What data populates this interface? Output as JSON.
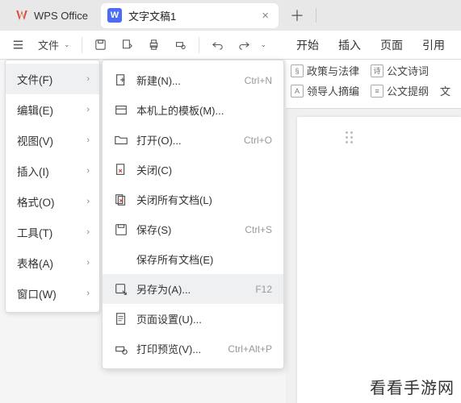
{
  "titlebar": {
    "app_name": "WPS Office",
    "doc_icon_letter": "W",
    "doc_title": "文字文稿1"
  },
  "toolbar": {
    "file_label": "文件",
    "ribbon_tabs": [
      "开始",
      "插入",
      "页面",
      "引用"
    ]
  },
  "gallery": {
    "row1": [
      {
        "icon": "§",
        "label": "政策与法律"
      },
      {
        "icon": "诗",
        "label": "公文诗词"
      }
    ],
    "row2": [
      {
        "icon": "A",
        "label": "领导人摘编"
      },
      {
        "icon": "≡",
        "label": "公文提纲"
      },
      {
        "icon": "",
        "label": "文"
      }
    ]
  },
  "menu1": [
    {
      "label": "文件(F)",
      "active": true
    },
    {
      "label": "编辑(E)",
      "active": false
    },
    {
      "label": "视图(V)",
      "active": false
    },
    {
      "label": "插入(I)",
      "active": false
    },
    {
      "label": "格式(O)",
      "active": false
    },
    {
      "label": "工具(T)",
      "active": false
    },
    {
      "label": "表格(A)",
      "active": false
    },
    {
      "label": "窗口(W)",
      "active": false
    }
  ],
  "menu2": [
    {
      "icon": "new",
      "label": "新建(N)...",
      "shortcut": "Ctrl+N"
    },
    {
      "icon": "template",
      "label": "本机上的模板(M)...",
      "shortcut": ""
    },
    {
      "icon": "open",
      "label": "打开(O)...",
      "shortcut": "Ctrl+O"
    },
    {
      "icon": "close",
      "label": "关闭(C)",
      "shortcut": ""
    },
    {
      "icon": "closeall",
      "label": "关闭所有文档(L)",
      "shortcut": ""
    },
    {
      "icon": "save",
      "label": "保存(S)",
      "shortcut": "Ctrl+S"
    },
    {
      "icon": "",
      "label": "保存所有文档(E)",
      "shortcut": "",
      "indent": true
    },
    {
      "icon": "saveas",
      "label": "另存为(A)...",
      "shortcut": "F12",
      "hover": true
    },
    {
      "icon": "pagesetup",
      "label": "页面设置(U)...",
      "shortcut": ""
    },
    {
      "icon": "preview",
      "label": "打印预览(V)...",
      "shortcut": "Ctrl+Alt+P"
    }
  ],
  "watermark": "看看手游网"
}
